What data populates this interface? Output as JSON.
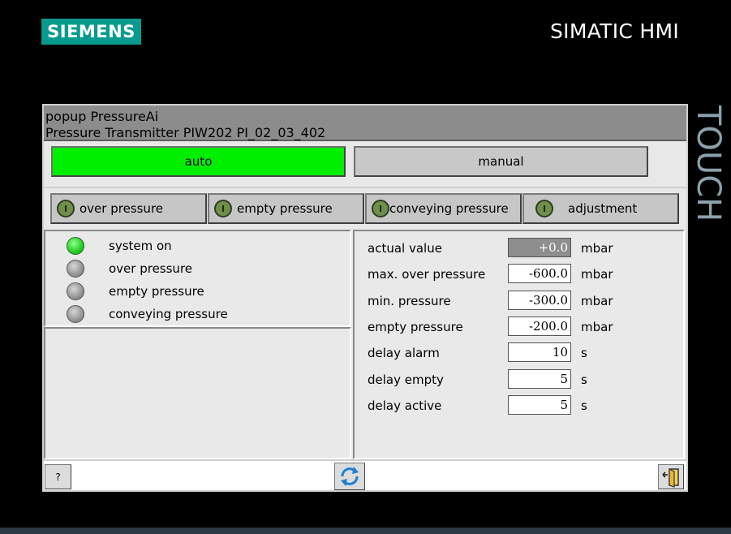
{
  "header": {
    "brand": "SIEMENS",
    "product": "SIMATIC HMI",
    "side_label": "TOUCH"
  },
  "popup": {
    "title": "popup PressureAi",
    "subtitle": "Pressure Transmitter PIW202 PI_02_03_402"
  },
  "modes": {
    "auto": {
      "label": "auto",
      "active": true,
      "color": "#00ee00"
    },
    "manual": {
      "label": "manual",
      "active": false,
      "color": "#c8c8c8"
    }
  },
  "tabs": [
    {
      "label": "over pressure",
      "indicator": "I"
    },
    {
      "label": "empty pressure",
      "indicator": "I"
    },
    {
      "label": "conveying pressure",
      "indicator": "I"
    },
    {
      "label": "adjustment",
      "indicator": "I"
    }
  ],
  "status": [
    {
      "label": "system on",
      "state": "on",
      "color": "#14c414"
    },
    {
      "label": "over pressure",
      "state": "off",
      "color": "#8a8a8a"
    },
    {
      "label": "empty pressure",
      "state": "off",
      "color": "#8a8a8a"
    },
    {
      "label": "conveying pressure",
      "state": "off",
      "color": "#8a8a8a"
    }
  ],
  "values": [
    {
      "label": "actual value",
      "value": "+0.0",
      "unit": "mbar",
      "readonly": true
    },
    {
      "label": "max. over pressure",
      "value": "-600.0",
      "unit": "mbar",
      "readonly": false
    },
    {
      "label": "min. pressure",
      "value": "-300.0",
      "unit": "mbar",
      "readonly": false
    },
    {
      "label": "empty pressure",
      "value": "-200.0",
      "unit": "mbar",
      "readonly": false
    },
    {
      "label": "delay alarm",
      "value": "10",
      "unit": "s",
      "readonly": false
    },
    {
      "label": "delay empty",
      "value": "5",
      "unit": "s",
      "readonly": false
    },
    {
      "label": "delay active",
      "value": "5",
      "unit": "s",
      "readonly": false
    }
  ],
  "footer": {
    "help_label": "?",
    "refresh_icon": "refresh-icon",
    "exit_icon": "exit-door-icon"
  }
}
